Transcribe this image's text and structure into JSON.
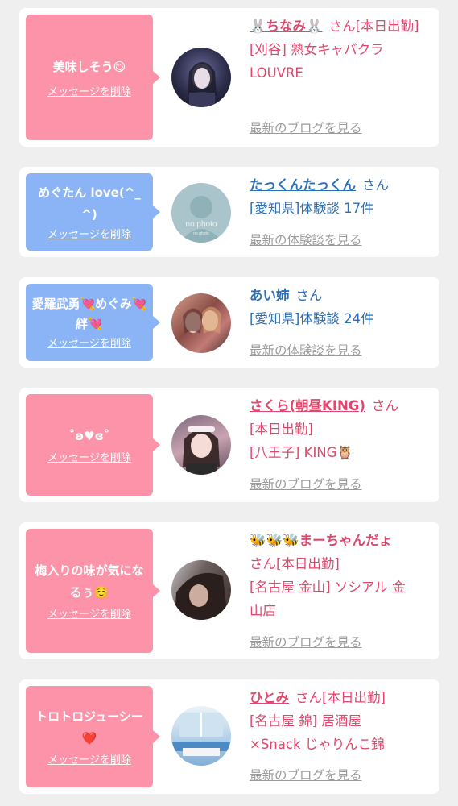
{
  "delete_label": "メッセージを削除",
  "san_label": "さん",
  "colors": {
    "pink_bubble": "#fc93a8",
    "blue_bubble": "#8ab4f5",
    "pink_text": "#e0476c",
    "blue_text": "#2d6fb6",
    "gray_link": "#9a9a9a"
  },
  "items": [
    {
      "message": "美味しそう😋",
      "name": "🐰ちなみ🐰",
      "line1_suffix": "[本日出勤]",
      "line2": "[刈谷] 熟女キャバクラ",
      "line3": "LOUVRE",
      "link": "最新のブログを見る"
    },
    {
      "message": "めぐたん love(^_^)",
      "name": "たっくんたっくん",
      "line2": "[愛知県]体験談 17件",
      "link": "最新の体験談を見る",
      "avatar_text_1": "no photo",
      "avatar_text_2": "no photo"
    },
    {
      "message": "愛羅武勇💘めぐみ💘絆💘",
      "name": "あい姉",
      "line2": "[愛知県]体験談 24件",
      "link": "最新の体験談を見る"
    },
    {
      "message": "˚ʚ♥ɞ˚",
      "name": "さくら(朝昼KING)",
      "line1": "[本日出勤]",
      "line2": "[八王子] KING🦉",
      "link": "最新のブログを見る"
    },
    {
      "message": "梅入りの味が気になるぅ☺️",
      "name": "🐝🐝🐝まーちゃんだょ",
      "line1": "さん[本日出勤]",
      "line2": "[名古屋 金山] ソシアル 金",
      "line3": "山店",
      "link": "最新のブログを見る"
    },
    {
      "message": "トロトロジューシー❤️",
      "name": "ひとみ",
      "line1_suffix": "[本日出勤]",
      "line2": "[名古屋 錦] 居酒屋",
      "line3": "×Snack じゃりんこ錦",
      "link": "最新のブログを見る"
    }
  ]
}
